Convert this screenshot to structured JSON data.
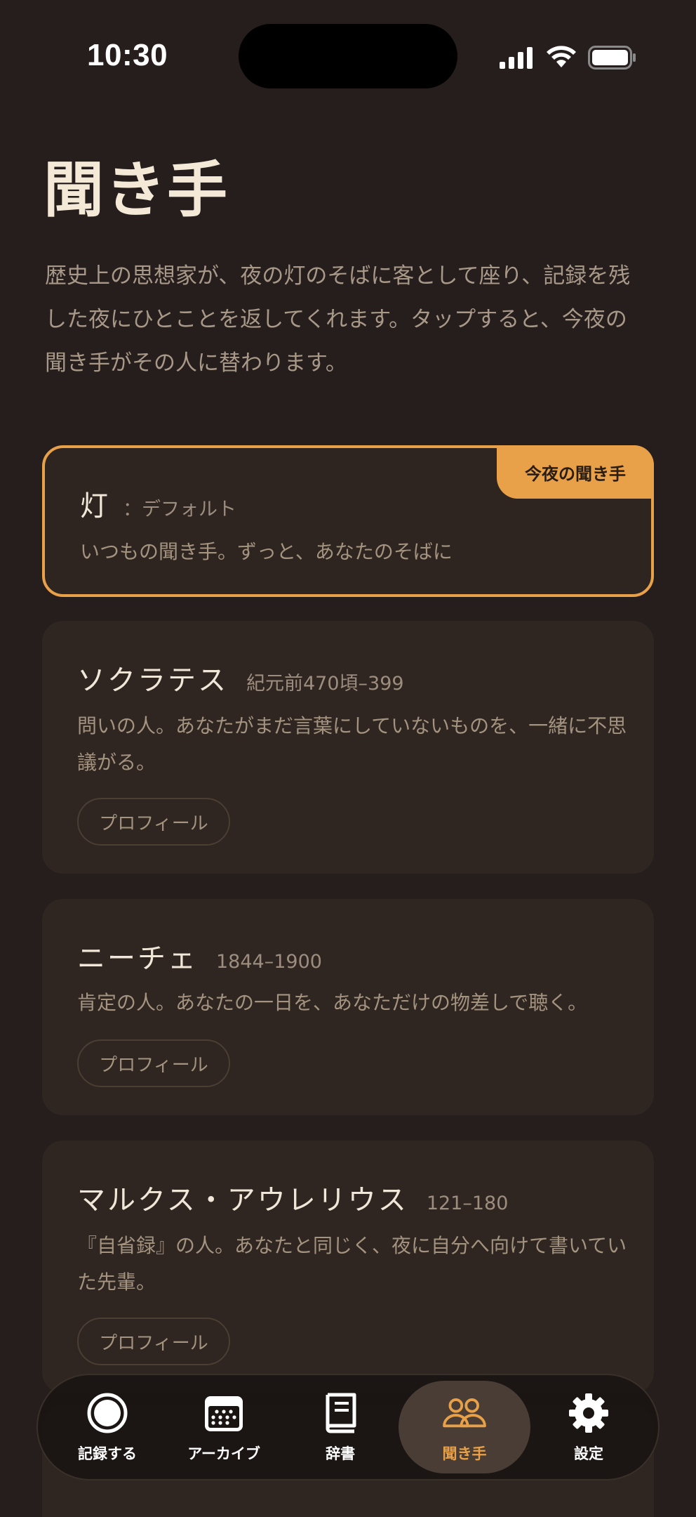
{
  "status_bar": {
    "time": "10:30"
  },
  "header": {
    "title": "聞き手",
    "intro": "歴史上の思想家が、夜の灯のそばに客として座り、記録を残した夜にひとことを返してくれます。タップすると、今夜の聞き手がその人に替わります。"
  },
  "listeners": [
    {
      "name": "灯",
      "meta": "：デフォルト",
      "desc": "いつもの聞き手。ずっと、あなたのそばに",
      "badge": "今夜の聞き手"
    },
    {
      "name": "ソクラテス",
      "meta": "紀元前470頃–399",
      "desc": "問いの人。あなたがまだ言葉にしていないものを、一緒に不思議がる。",
      "profile": "プロフィール"
    },
    {
      "name": "ニーチェ",
      "meta": "1844–1900",
      "desc": "肯定の人。あなたの一日を、あなただけの物差しで聴く。",
      "profile": "プロフィール"
    },
    {
      "name": "マルクス・アウレリウス",
      "meta": "121–180",
      "desc": "『自省録』の人。あなたと同じく、夜に自分へ向けて書いていた先輩。",
      "profile": "プロフィール"
    }
  ],
  "tabs": [
    {
      "label": "記録する",
      "icon": "record-icon"
    },
    {
      "label": "アーカイブ",
      "icon": "calendar-icon"
    },
    {
      "label": "辞書",
      "icon": "book-icon"
    },
    {
      "label": "聞き手",
      "icon": "people-icon",
      "selected": true
    },
    {
      "label": "設定",
      "icon": "gear-icon"
    }
  ],
  "colors": {
    "accent": "#e9a149",
    "background": "#261e1c",
    "card": "#2f2621"
  }
}
